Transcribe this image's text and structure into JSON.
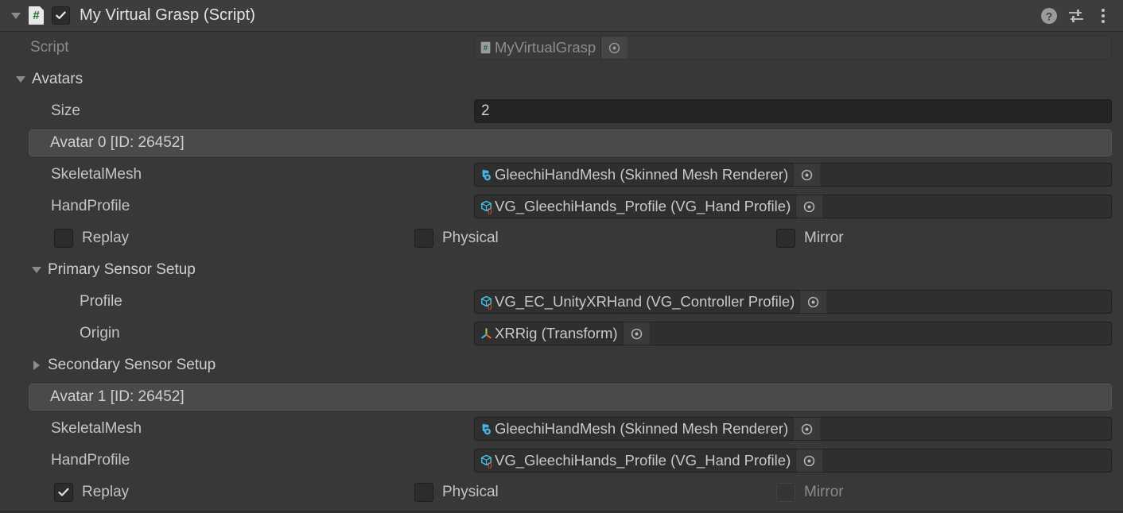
{
  "header": {
    "foldout_icon": "triangle-down-icon",
    "script_icon": "csharp-script-icon",
    "script_icon_glyph": "#",
    "enabled": true,
    "title": "My Virtual Grasp (Script)",
    "help_icon": "help-icon",
    "preset_icon": "preset-sliders-icon",
    "menu_icon": "kebab-menu-icon"
  },
  "fields": {
    "script": {
      "label": "Script",
      "value": "MyVirtualGrasp",
      "icon": "csharp-script-icon",
      "disabled": true
    },
    "avatars": {
      "label": "Avatars",
      "expanded": true,
      "size_label": "Size",
      "size_value": "2"
    }
  },
  "avatars": [
    {
      "band_label": "Avatar 0 [ID: 26452]",
      "skeletal_mesh": {
        "label": "SkeletalMesh",
        "value": "GleechiHandMesh (Skinned Mesh Renderer)",
        "icon": "skinned-mesh-renderer-icon"
      },
      "hand_profile": {
        "label": "HandProfile",
        "value": "VG_GleechiHands_Profile (VG_Hand Profile)",
        "icon": "scriptable-object-icon"
      },
      "toggles": [
        {
          "label": "Replay",
          "checked": false,
          "disabled": false
        },
        {
          "label": "Physical",
          "checked": false,
          "disabled": false
        },
        {
          "label": "Mirror",
          "checked": false,
          "disabled": false
        }
      ],
      "primary_sensor": {
        "label": "Primary Sensor Setup",
        "expanded": true,
        "profile": {
          "label": "Profile",
          "value": "VG_EC_UnityXRHand (VG_Controller Profile)",
          "icon": "scriptable-object-icon"
        },
        "origin": {
          "label": "Origin",
          "value": "XRRig (Transform)",
          "icon": "transform-gizmo-icon"
        }
      },
      "secondary_sensor": {
        "label": "Secondary Sensor Setup",
        "expanded": false
      }
    },
    {
      "band_label": "Avatar 1 [ID: 26452]",
      "skeletal_mesh": {
        "label": "SkeletalMesh",
        "value": "GleechiHandMesh (Skinned Mesh Renderer)",
        "icon": "skinned-mesh-renderer-icon"
      },
      "hand_profile": {
        "label": "HandProfile",
        "value": "VG_GleechiHands_Profile (VG_Hand Profile)",
        "icon": "scriptable-object-icon"
      },
      "toggles": [
        {
          "label": "Replay",
          "checked": true,
          "disabled": false
        },
        {
          "label": "Physical",
          "checked": false,
          "disabled": false
        },
        {
          "label": "Mirror",
          "checked": false,
          "disabled": true
        }
      ]
    }
  ],
  "colors": {
    "background": "#383838",
    "header_background": "#3d3d3d",
    "band_background": "#4a4a4a",
    "field_background": "#2f2f2f",
    "input_background": "#242424",
    "text": "#c4c4c4",
    "text_dim": "#8a8a8a",
    "icon_blue": "#4db2e8",
    "icon_cyan": "#3fc6e8",
    "icon_orange": "#e8622d",
    "icon_green": "#1d6b2a"
  }
}
